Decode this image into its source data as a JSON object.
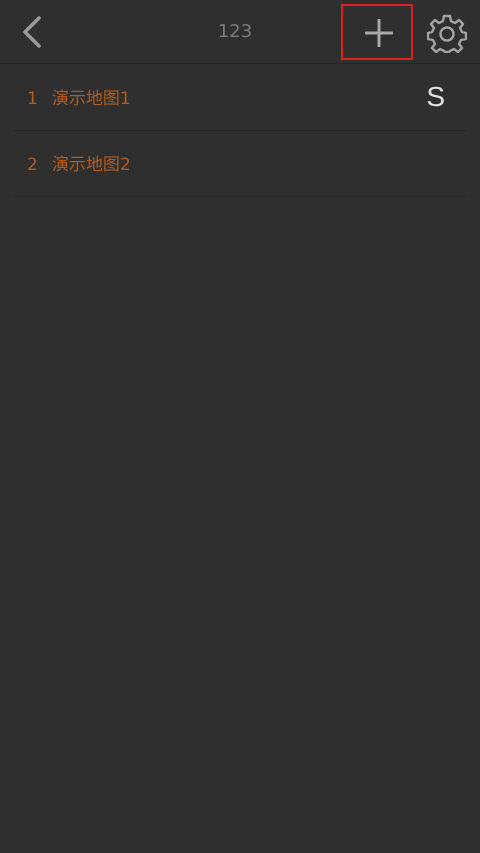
{
  "header": {
    "title": "123",
    "icons": {
      "back": "chevron-left-icon",
      "add": "plus-icon",
      "settings": "gear-icon"
    }
  },
  "maps": [
    {
      "number": "1",
      "name": "演示地图1",
      "badge": "S"
    },
    {
      "number": "2",
      "name": "演示地图2",
      "badge": ""
    }
  ],
  "colors": {
    "background": "#2f2f2f",
    "item_text": "#b05c1f",
    "highlight_box": "#e02020"
  }
}
